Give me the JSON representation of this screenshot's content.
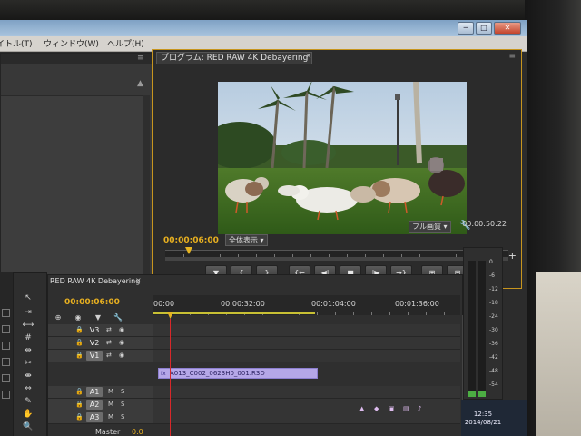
{
  "menu": {
    "items": [
      "イトル(T)",
      "ウィンドウ(W)",
      "ヘルプ(H)"
    ]
  },
  "window_controls": {
    "minimize": "─",
    "maximize": "□",
    "close": "✕"
  },
  "program_monitor": {
    "tab_label": "プログラム: RED RAW 4K Debayering",
    "tab_close": "×",
    "panel_menu": "≡",
    "current_time": "00:00:06:00",
    "duration": "00:00:50:22",
    "fit_dropdown": "全体表示",
    "quality_dropdown": "フル画質",
    "add_button": "+",
    "controls": [
      {
        "name": "marker-button",
        "symbol": "▼"
      },
      {
        "name": "mark-in-button",
        "symbol": "{"
      },
      {
        "name": "mark-out-button",
        "symbol": "}"
      },
      {
        "name": "go-to-in-button",
        "symbol": "{←"
      },
      {
        "name": "step-back-button",
        "symbol": "◀|"
      },
      {
        "name": "stop-button",
        "symbol": "■"
      },
      {
        "name": "step-forward-button",
        "symbol": "|▶"
      },
      {
        "name": "go-to-out-button",
        "symbol": "→}"
      },
      {
        "name": "lift-button",
        "symbol": "⊞"
      },
      {
        "name": "extract-button",
        "symbol": "⊟"
      },
      {
        "name": "export-frame-button",
        "symbol": "◙"
      }
    ]
  },
  "timeline": {
    "tab_label": "RED RAW 4K Debayering",
    "tab_close": "×",
    "current_time": "00:00:06:00",
    "ruler_labels": [
      "00:00",
      "00:00:32:00",
      "00:01:04:00",
      "00:01:36:00"
    ],
    "tracks": [
      {
        "label": "V3",
        "type": "video"
      },
      {
        "label": "V2",
        "type": "video"
      },
      {
        "label": "V1",
        "type": "video"
      },
      {
        "label": "A1",
        "type": "audio"
      },
      {
        "label": "A2",
        "type": "audio"
      },
      {
        "label": "A3",
        "type": "audio"
      }
    ],
    "clip_name": "A013_C002_0623H0_001.R3D",
    "clip_fx": "fx",
    "master_label": "Master",
    "master_value": "0.0",
    "mute_label": "M",
    "solo_label": "S"
  },
  "audio_meter": {
    "labels": [
      "0",
      "-6",
      "-12",
      "-18",
      "-24",
      "-30",
      "-36",
      "-42",
      "-48",
      "-54"
    ]
  },
  "taskbar": {
    "time": "12:35",
    "date": "2014/08/21"
  },
  "colors": {
    "accent": "#e8b020",
    "clip": "#b5a7e8",
    "playhead_line": "#d8282a",
    "panel": "#2f2f2f"
  }
}
